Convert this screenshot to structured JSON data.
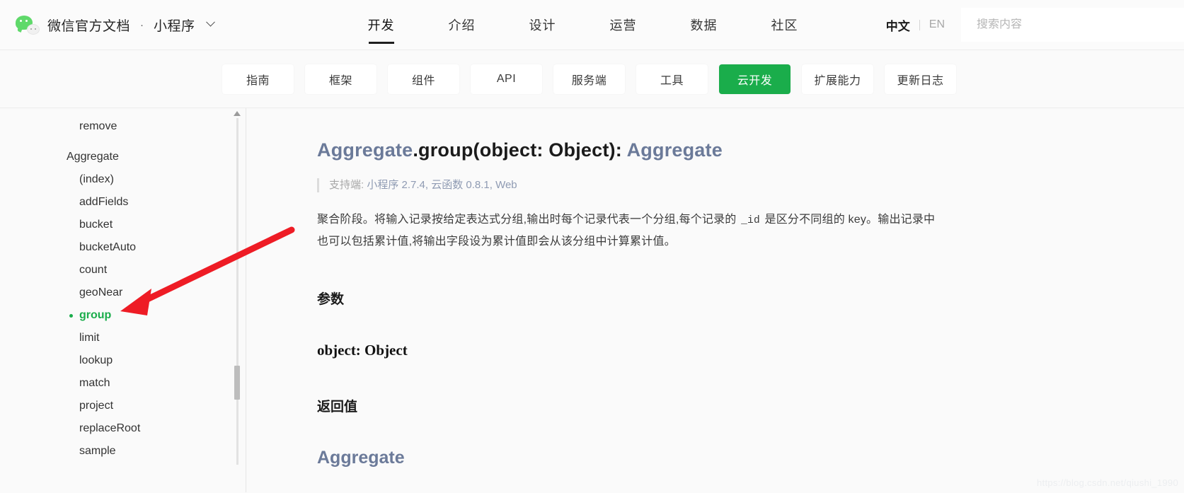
{
  "header": {
    "logo_icon": "wechat-logo-icon",
    "brand": "微信官方文档",
    "separator": "·",
    "product": "小程序",
    "product_caret_icon": "chevron-down-icon",
    "nav": [
      {
        "label": "开发",
        "active": true
      },
      {
        "label": "介绍",
        "active": false
      },
      {
        "label": "设计",
        "active": false
      },
      {
        "label": "运营",
        "active": false
      },
      {
        "label": "数据",
        "active": false
      },
      {
        "label": "社区",
        "active": false
      }
    ],
    "lang": {
      "zh": "中文",
      "en": "EN"
    },
    "search": {
      "value": "",
      "placeholder": "搜索内容",
      "icon": "search-icon"
    }
  },
  "subnav": {
    "items": [
      {
        "label": "指南",
        "active": false
      },
      {
        "label": "框架",
        "active": false
      },
      {
        "label": "组件",
        "active": false
      },
      {
        "label": "API",
        "active": false
      },
      {
        "label": "服务端",
        "active": false
      },
      {
        "label": "工具",
        "active": false
      },
      {
        "label": "云开发",
        "active": true
      },
      {
        "label": "扩展能力",
        "active": false
      },
      {
        "label": "更新日志",
        "active": false
      }
    ],
    "active_color": "#1aad4b"
  },
  "sidebar": {
    "items": [
      {
        "label": "remove",
        "type": "leaf",
        "active": false
      },
      {
        "label": "Aggregate",
        "type": "group",
        "active": false
      },
      {
        "label": "(index)",
        "type": "leaf",
        "active": false
      },
      {
        "label": "addFields",
        "type": "leaf",
        "active": false
      },
      {
        "label": "bucket",
        "type": "leaf",
        "active": false
      },
      {
        "label": "bucketAuto",
        "type": "leaf",
        "active": false
      },
      {
        "label": "count",
        "type": "leaf",
        "active": false
      },
      {
        "label": "geoNear",
        "type": "leaf",
        "active": false
      },
      {
        "label": "group",
        "type": "leaf",
        "active": true
      },
      {
        "label": "limit",
        "type": "leaf",
        "active": false
      },
      {
        "label": "lookup",
        "type": "leaf",
        "active": false
      },
      {
        "label": "match",
        "type": "leaf",
        "active": false
      },
      {
        "label": "project",
        "type": "leaf",
        "active": false
      },
      {
        "label": "replaceRoot",
        "type": "leaf",
        "active": false
      },
      {
        "label": "sample",
        "type": "leaf",
        "active": false
      }
    ],
    "active_color": "#1aad4b",
    "scroll_up_icon": "scroll-up-arrow-icon"
  },
  "main": {
    "title_class": "Aggregate",
    "title_signature": ".group(object: Object): ",
    "title_return": "Aggregate",
    "support_label": "支持端:",
    "support_versions": "小程序 2.7.4, 云函数 0.8.1, Web",
    "description_part1": "聚合阶段。将输入记录按给定表达式分组,输出时每个记录代表一个分组,每个记录的 ",
    "description_code": "_id",
    "description_part2": " 是区分不同组的 key。输出记录中也可以包括累计值,将输出字段设为累计值即会从该分组中计算累计值。",
    "params_heading": "参数",
    "param_name": "object: Object",
    "returns_heading": "返回值",
    "return_type": "Aggregate"
  },
  "annotation": {
    "arrow_color": "#ee1c25",
    "arrow_target": "group"
  },
  "watermark": {
    "text": "https://blog.csdn.net/qiushi_1990"
  }
}
